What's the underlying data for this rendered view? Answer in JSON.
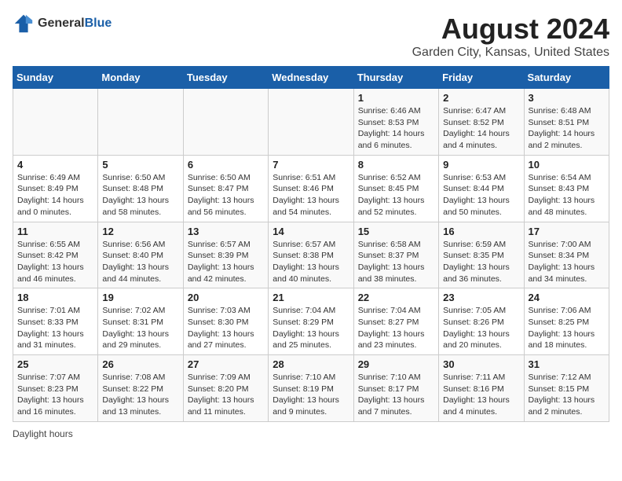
{
  "header": {
    "logo_general": "General",
    "logo_blue": "Blue",
    "title": "August 2024",
    "subtitle": "Garden City, Kansas, United States"
  },
  "days_of_week": [
    "Sunday",
    "Monday",
    "Tuesday",
    "Wednesday",
    "Thursday",
    "Friday",
    "Saturday"
  ],
  "weeks": [
    [
      {
        "day": "",
        "info": ""
      },
      {
        "day": "",
        "info": ""
      },
      {
        "day": "",
        "info": ""
      },
      {
        "day": "",
        "info": ""
      },
      {
        "day": "1",
        "info": "Sunrise: 6:46 AM\nSunset: 8:53 PM\nDaylight: 14 hours\nand 6 minutes."
      },
      {
        "day": "2",
        "info": "Sunrise: 6:47 AM\nSunset: 8:52 PM\nDaylight: 14 hours\nand 4 minutes."
      },
      {
        "day": "3",
        "info": "Sunrise: 6:48 AM\nSunset: 8:51 PM\nDaylight: 14 hours\nand 2 minutes."
      }
    ],
    [
      {
        "day": "4",
        "info": "Sunrise: 6:49 AM\nSunset: 8:49 PM\nDaylight: 14 hours\nand 0 minutes."
      },
      {
        "day": "5",
        "info": "Sunrise: 6:50 AM\nSunset: 8:48 PM\nDaylight: 13 hours\nand 58 minutes."
      },
      {
        "day": "6",
        "info": "Sunrise: 6:50 AM\nSunset: 8:47 PM\nDaylight: 13 hours\nand 56 minutes."
      },
      {
        "day": "7",
        "info": "Sunrise: 6:51 AM\nSunset: 8:46 PM\nDaylight: 13 hours\nand 54 minutes."
      },
      {
        "day": "8",
        "info": "Sunrise: 6:52 AM\nSunset: 8:45 PM\nDaylight: 13 hours\nand 52 minutes."
      },
      {
        "day": "9",
        "info": "Sunrise: 6:53 AM\nSunset: 8:44 PM\nDaylight: 13 hours\nand 50 minutes."
      },
      {
        "day": "10",
        "info": "Sunrise: 6:54 AM\nSunset: 8:43 PM\nDaylight: 13 hours\nand 48 minutes."
      }
    ],
    [
      {
        "day": "11",
        "info": "Sunrise: 6:55 AM\nSunset: 8:42 PM\nDaylight: 13 hours\nand 46 minutes."
      },
      {
        "day": "12",
        "info": "Sunrise: 6:56 AM\nSunset: 8:40 PM\nDaylight: 13 hours\nand 44 minutes."
      },
      {
        "day": "13",
        "info": "Sunrise: 6:57 AM\nSunset: 8:39 PM\nDaylight: 13 hours\nand 42 minutes."
      },
      {
        "day": "14",
        "info": "Sunrise: 6:57 AM\nSunset: 8:38 PM\nDaylight: 13 hours\nand 40 minutes."
      },
      {
        "day": "15",
        "info": "Sunrise: 6:58 AM\nSunset: 8:37 PM\nDaylight: 13 hours\nand 38 minutes."
      },
      {
        "day": "16",
        "info": "Sunrise: 6:59 AM\nSunset: 8:35 PM\nDaylight: 13 hours\nand 36 minutes."
      },
      {
        "day": "17",
        "info": "Sunrise: 7:00 AM\nSunset: 8:34 PM\nDaylight: 13 hours\nand 34 minutes."
      }
    ],
    [
      {
        "day": "18",
        "info": "Sunrise: 7:01 AM\nSunset: 8:33 PM\nDaylight: 13 hours\nand 31 minutes."
      },
      {
        "day": "19",
        "info": "Sunrise: 7:02 AM\nSunset: 8:31 PM\nDaylight: 13 hours\nand 29 minutes."
      },
      {
        "day": "20",
        "info": "Sunrise: 7:03 AM\nSunset: 8:30 PM\nDaylight: 13 hours\nand 27 minutes."
      },
      {
        "day": "21",
        "info": "Sunrise: 7:04 AM\nSunset: 8:29 PM\nDaylight: 13 hours\nand 25 minutes."
      },
      {
        "day": "22",
        "info": "Sunrise: 7:04 AM\nSunset: 8:27 PM\nDaylight: 13 hours\nand 23 minutes."
      },
      {
        "day": "23",
        "info": "Sunrise: 7:05 AM\nSunset: 8:26 PM\nDaylight: 13 hours\nand 20 minutes."
      },
      {
        "day": "24",
        "info": "Sunrise: 7:06 AM\nSunset: 8:25 PM\nDaylight: 13 hours\nand 18 minutes."
      }
    ],
    [
      {
        "day": "25",
        "info": "Sunrise: 7:07 AM\nSunset: 8:23 PM\nDaylight: 13 hours\nand 16 minutes."
      },
      {
        "day": "26",
        "info": "Sunrise: 7:08 AM\nSunset: 8:22 PM\nDaylight: 13 hours\nand 13 minutes."
      },
      {
        "day": "27",
        "info": "Sunrise: 7:09 AM\nSunset: 8:20 PM\nDaylight: 13 hours\nand 11 minutes."
      },
      {
        "day": "28",
        "info": "Sunrise: 7:10 AM\nSunset: 8:19 PM\nDaylight: 13 hours\nand 9 minutes."
      },
      {
        "day": "29",
        "info": "Sunrise: 7:10 AM\nSunset: 8:17 PM\nDaylight: 13 hours\nand 7 minutes."
      },
      {
        "day": "30",
        "info": "Sunrise: 7:11 AM\nSunset: 8:16 PM\nDaylight: 13 hours\nand 4 minutes."
      },
      {
        "day": "31",
        "info": "Sunrise: 7:12 AM\nSunset: 8:15 PM\nDaylight: 13 hours\nand 2 minutes."
      }
    ]
  ],
  "footer": {
    "daylight_hours_label": "Daylight hours"
  }
}
